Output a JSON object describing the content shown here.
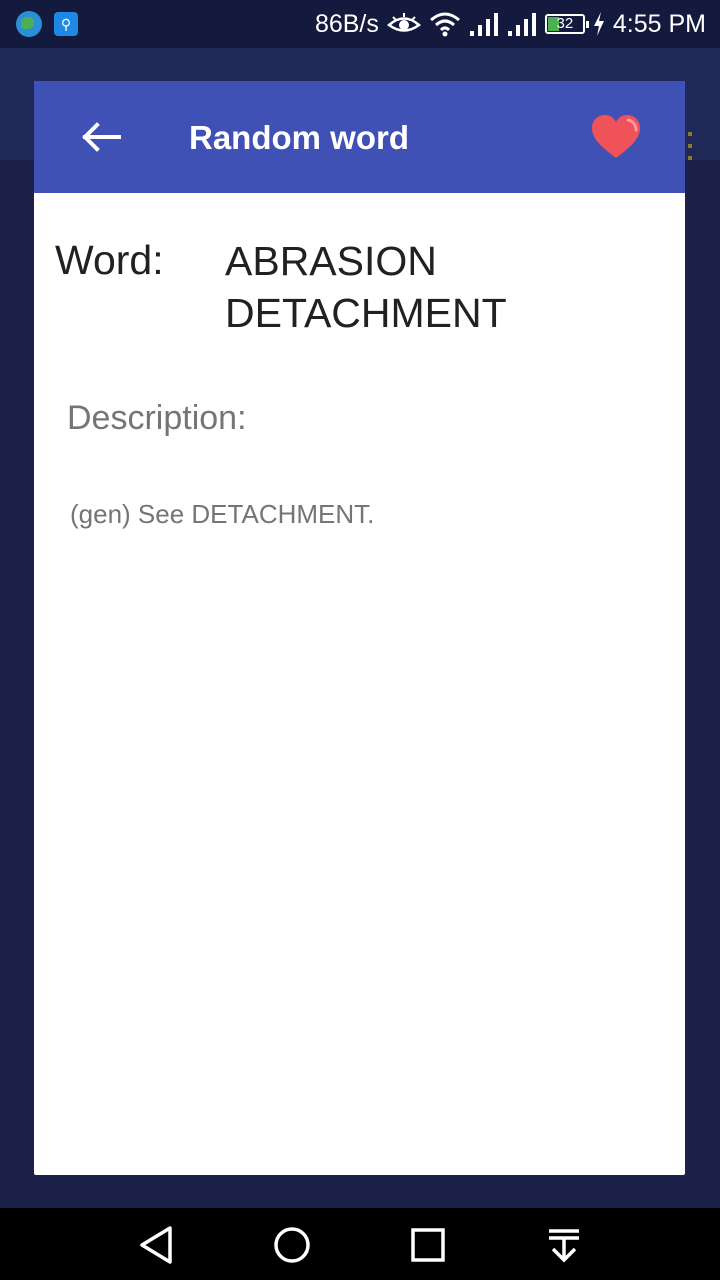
{
  "status_bar": {
    "speed": "86B/s",
    "battery": "32",
    "time": "4:55 PM",
    "icons": [
      "globe-icon",
      "usb-icon",
      "eye-icon",
      "wifi-icon",
      "signal-icon",
      "signal-icon",
      "battery-icon",
      "charging-icon"
    ]
  },
  "dialog": {
    "title": "Random word",
    "word_label": "Word:",
    "word_value": "ABRASION DETACHMENT",
    "description_label": "Description:",
    "description_value": "(gen) See DETACHMENT."
  },
  "colors": {
    "header": "#3f51b5",
    "heart": "#f0525a",
    "background": "#1b2148"
  },
  "nav_bar": {
    "icons": [
      "back-icon",
      "home-icon",
      "recents-icon",
      "notification-pull-icon"
    ]
  }
}
